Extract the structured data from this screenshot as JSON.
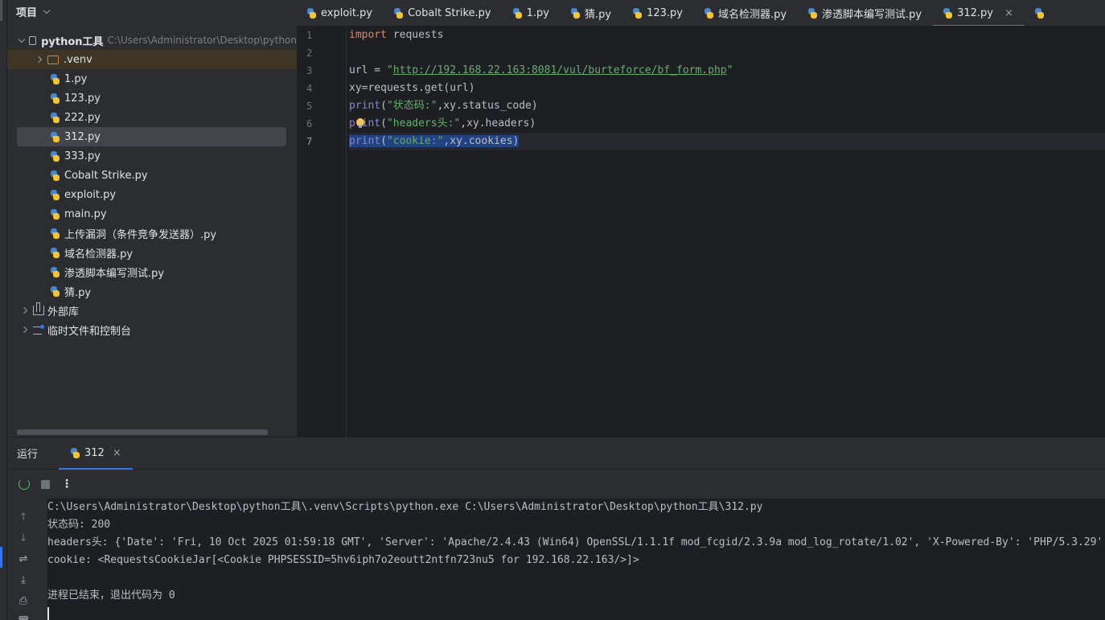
{
  "project_panel": {
    "title": "项目",
    "root": {
      "name": "python工具",
      "path": "C:\\Users\\Administrator\\Desktop\\python"
    },
    "venv": ".venv",
    "files": [
      "1.py",
      "123.py",
      "222.py",
      "312.py",
      "333.py",
      "Cobalt Strike.py",
      "exploit.py",
      "main.py",
      "上传漏洞（条件竞争发送器）.py",
      "域名检测器.py",
      "渗透脚本编写测试.py",
      "猜.py"
    ],
    "external_libs": "外部库",
    "scratches": "临时文件和控制台"
  },
  "editor_tabs": [
    {
      "label": "exploit.py"
    },
    {
      "label": "Cobalt Strike.py"
    },
    {
      "label": "1.py"
    },
    {
      "label": "猜.py"
    },
    {
      "label": "123.py"
    },
    {
      "label": "域名检测器.py"
    },
    {
      "label": "渗透脚本编写测试.py"
    },
    {
      "label": "312.py",
      "close": "×"
    }
  ],
  "code": {
    "line_numbers": [
      "1",
      "2",
      "3",
      "4",
      "5",
      "6",
      "7"
    ],
    "l1_kw": "import",
    "l1_rest": " requests",
    "l3_pre": "url = ",
    "l3_q1": "\"",
    "l3_url": "http://192.168.22.163:8081/vul/burteforce/bf_form.php",
    "l3_q2": "\"",
    "l4": "xy=requests.get(url)",
    "l5_fn": "print",
    "l5_paren": "(",
    "l5_str": "\"状态码:\"",
    "l5_rest": ",xy.status_code)",
    "l6_fn": "print",
    "l6_paren": "(",
    "l6_str": "\"headers头:\"",
    "l6_rest": ",xy.headers)",
    "l7_fn": "print",
    "l7_paren": "(",
    "l7_str": "\"cookie:\"",
    "l7_rest": ",xy.cookies)"
  },
  "run_panel": {
    "title": "运行",
    "tab_label": "312",
    "tab_close": "×",
    "more": "⋮",
    "console_lines": [
      "C:\\Users\\Administrator\\Desktop\\python工具\\.venv\\Scripts\\python.exe C:\\Users\\Administrator\\Desktop\\python工具\\312.py",
      "状态码: 200",
      "headers头: {'Date': 'Fri, 10 Oct 2025 01:59:18 GMT', 'Server': 'Apache/2.4.43 (Win64) OpenSSL/1.1.1f mod_fcgid/2.3.9a mod_log_rotate/1.02', 'X-Powered-By': 'PHP/5.3.29',",
      "cookie: <RequestsCookieJar[<Cookie PHPSESSID=5hv6iph7o2eoutt2ntfn723nu5 for 192.168.22.163/>]>",
      "",
      "进程已结束，退出代码为 0"
    ]
  }
}
